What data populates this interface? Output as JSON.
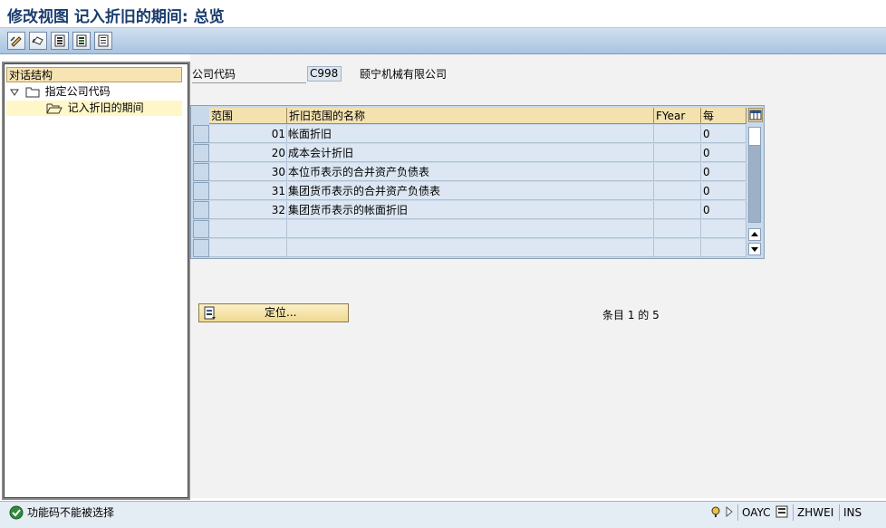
{
  "window": {
    "title": "修改视图 记入折旧的期间: 总览"
  },
  "toolbar": {
    "buttons": [
      {
        "icon": "change-display-icon"
      },
      {
        "icon": "undo-icon"
      },
      {
        "icon": "select-all-icon"
      },
      {
        "icon": "select-block-icon"
      },
      {
        "icon": "deselect-all-icon"
      }
    ]
  },
  "nav": {
    "header": "对话结构",
    "items": [
      {
        "label": "指定公司代码",
        "level": 1,
        "expanded": true
      },
      {
        "label": "记入折旧的期间",
        "level": 2,
        "selected": true
      }
    ]
  },
  "header_fields": {
    "company_code_label": "公司代码",
    "company_code_value": "C998",
    "company_name": "颐宁机械有限公司"
  },
  "table": {
    "columns": [
      "范围",
      "折旧范围的名称",
      "FYear",
      "每"
    ],
    "rows": [
      {
        "area": "01",
        "name": "帐面折旧",
        "fyear": "",
        "per": "0"
      },
      {
        "area": "20",
        "name": "成本会计折旧",
        "fyear": "",
        "per": "0"
      },
      {
        "area": "30",
        "name": "本位币表示的合并资产负债表",
        "fyear": "",
        "per": "0"
      },
      {
        "area": "31",
        "name": "集团货币表示的合并资产负债表",
        "fyear": "",
        "per": "0"
      },
      {
        "area": "32",
        "name": "集团货币表示的帐面折旧",
        "fyear": "",
        "per": "0"
      },
      {
        "area": "",
        "name": "",
        "fyear": "",
        "per": ""
      },
      {
        "area": "",
        "name": "",
        "fyear": "",
        "per": ""
      }
    ]
  },
  "position_button": {
    "label": "定位..."
  },
  "entry_counter": "条目 1 的 5",
  "status": {
    "message": "功能码不能被选择",
    "transaction": "OAYC",
    "user": "ZHWEI",
    "mode": "INS"
  },
  "colors": {
    "title": "#1a3d6d",
    "table_bg": "#c8d9eb",
    "cell_bg": "#dce7f3",
    "header_bg": "#f3e2b0",
    "status_ok": "#2e8b3a"
  }
}
